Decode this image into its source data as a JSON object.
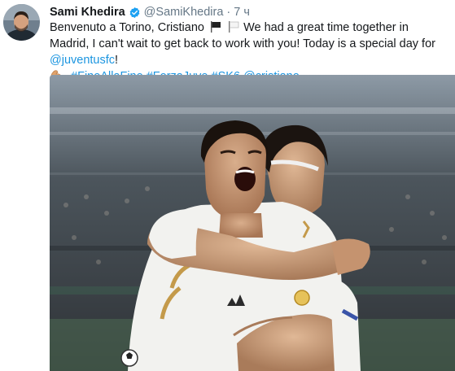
{
  "tweet": {
    "author": {
      "name": "Sami Khedira",
      "handle": "@SamiKhedira",
      "separator": "·",
      "time": "7 ч"
    },
    "text": {
      "line1_a": "Benvenuto a Torino, Cristiano",
      "line1_b": "We had a great time together in Madrid, I can't wait to get back to work with you! Today is a special day for",
      "mention_juve": "@juventusfc",
      "bang": "!",
      "hashtag1": "#FinoAllaFine",
      "hashtag2": "#ForzaJuve",
      "hashtag3": "#SK6",
      "mention_cristiano": "@cristiano"
    },
    "icons": {
      "verified": "verified-badge-icon",
      "flag_black": "black-flag-icon",
      "flag_white": "white-flag-icon",
      "arm": "flexed-biceps-icon"
    },
    "colors": {
      "link": "#1b95e0",
      "verified": "#1da1f2",
      "text": "#14171a",
      "meta": "#657786"
    }
  }
}
